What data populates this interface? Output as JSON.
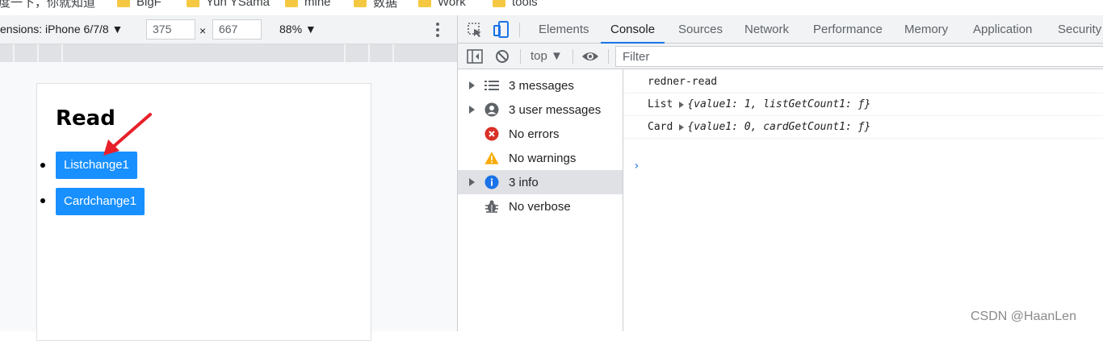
{
  "bookmarks": [
    {
      "label": "度一下，你就知道",
      "folder": false
    },
    {
      "label": "BigF",
      "folder": true
    },
    {
      "label": "Yun YSama",
      "folder": true
    },
    {
      "label": "mine",
      "folder": true
    },
    {
      "label": "数据",
      "folder": true
    },
    {
      "label": "Work",
      "folder": true
    },
    {
      "label": "tools",
      "folder": true
    }
  ],
  "device_toolbar": {
    "dimensions_label": "ensions: iPhone 6/7/8 ▼",
    "width_value": "375",
    "times_sign": "×",
    "height_value": "667",
    "zoom_label": "88% ▼",
    "more_icon": "kebab-icon"
  },
  "page": {
    "heading": "Read",
    "buttons": [
      "Listchange1",
      "Cardchange1"
    ],
    "button_color": "#1890ff",
    "arrow_color": "#e8202a"
  },
  "devtools": {
    "tabs": [
      "Elements",
      "Console",
      "Sources",
      "Network",
      "Performance",
      "Memory",
      "Application",
      "Security"
    ],
    "active_tab": "Console",
    "context": "top ▼",
    "filter_placeholder": "Filter",
    "sidebar": [
      {
        "label": "3 messages",
        "icon": "list-icon",
        "expandable": true,
        "selected": false
      },
      {
        "label": "3 user messages",
        "icon": "user-icon",
        "expandable": true,
        "selected": false
      },
      {
        "label": "No errors",
        "icon": "error-icon",
        "expandable": false,
        "selected": false
      },
      {
        "label": "No warnings",
        "icon": "warning-icon",
        "expandable": false,
        "selected": false
      },
      {
        "label": "3 info",
        "icon": "info-icon",
        "expandable": true,
        "selected": true
      },
      {
        "label": "No verbose",
        "icon": "bug-icon",
        "expandable": false,
        "selected": false
      }
    ],
    "console_logs": [
      {
        "prefix": "redner-read",
        "obj": ""
      },
      {
        "prefix": "List",
        "obj": "{value1: 1, listGetCount1: ƒ}"
      },
      {
        "prefix": "Card",
        "obj": "{value1: 0, cardGetCount1: ƒ}"
      }
    ],
    "prompt": "›"
  },
  "watermark": "CSDN @HaanLen",
  "colors": {
    "accent": "#1a73e8",
    "error": "#d93025",
    "warning": "#f9ab00",
    "info": "#1a73e8"
  }
}
